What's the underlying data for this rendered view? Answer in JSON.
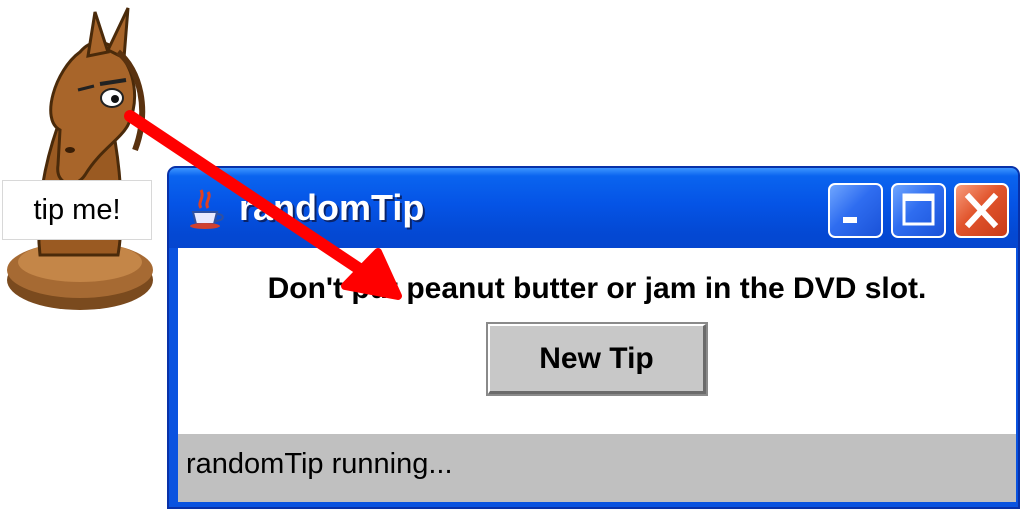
{
  "mascot": {
    "sign_text": "tip me!"
  },
  "window": {
    "title": "randomTip",
    "icon": "java-cup-icon",
    "controls": {
      "minimize": "minimize-icon",
      "maximize": "maximize-icon",
      "close": "close-icon"
    },
    "tip": "Don't put peanut butter or jam in the DVD slot.",
    "button_label": "New Tip",
    "status": "randomTip running..."
  },
  "colors": {
    "titlebar": "#0554e6",
    "close_button": "#e1542c",
    "arrow": "#ff0000",
    "status_bar": "#c0c0c0"
  }
}
